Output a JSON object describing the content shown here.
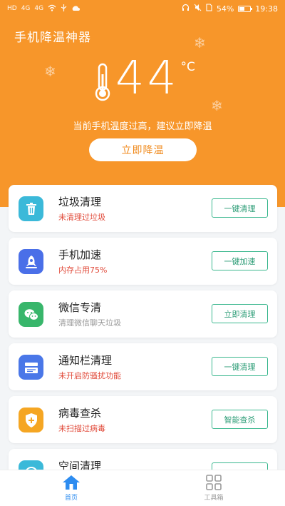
{
  "status_bar": {
    "left": [
      "HD",
      "4G",
      "4G",
      "WiFi",
      "USB",
      "Cloud"
    ],
    "battery": "54%",
    "time": "19:38"
  },
  "header": {
    "app_title": "手机降温神器",
    "temperature": "44",
    "unit": "°C",
    "advice": "当前手机温度过高，建议立即降温",
    "cool_button": "立即降温",
    "colors": {
      "header_bg": "#f7962a",
      "accent": "#f08a1c"
    }
  },
  "cards": [
    {
      "title": "垃圾清理",
      "subtitle": "未清理过垃圾",
      "subtitle_color": "red",
      "button": "一键清理",
      "icon": "trash-icon",
      "icon_color": "#3bb9d9"
    },
    {
      "title": "手机加速",
      "subtitle": "内存占用75%",
      "subtitle_color": "red",
      "button": "一键加速",
      "icon": "rocket-icon",
      "icon_color": "#4a6fe8"
    },
    {
      "title": "微信专清",
      "subtitle": "清理微信聊天垃圾",
      "subtitle_color": "gray",
      "button": "立即清理",
      "icon": "wechat-icon",
      "icon_color": "#38b66b"
    },
    {
      "title": "通知栏清理",
      "subtitle": "未开启防骚扰功能",
      "subtitle_color": "red",
      "button": "一键清理",
      "icon": "notification-icon",
      "icon_color": "#4a77e8"
    },
    {
      "title": "病毒查杀",
      "subtitle": "未扫描过病毒",
      "subtitle_color": "red",
      "button": "智能查杀",
      "icon": "shield-icon",
      "icon_color": "#f5a623"
    },
    {
      "title": "空间清理",
      "subtitle": "",
      "subtitle_color": "gray",
      "button": "",
      "icon": "storage-icon",
      "icon_color": "#3bb9d9"
    }
  ],
  "tabbar": {
    "tabs": [
      {
        "label": "首页",
        "icon": "home-icon",
        "active": true
      },
      {
        "label": "工具箱",
        "icon": "grid-icon",
        "active": false
      }
    ]
  }
}
